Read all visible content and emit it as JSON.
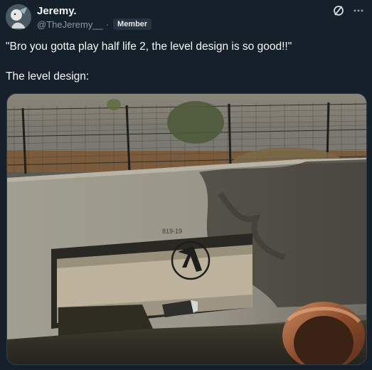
{
  "author": {
    "name": "Jeremy.",
    "handle": "@TheJeremy__",
    "separator": "·",
    "badge": "Member"
  },
  "icons": {
    "grok": "slash-circle-icon",
    "more": "more-horizontal-icon"
  },
  "tweet": {
    "line1": "\"Bro you gotta play half life 2, the level design is so good!!\"",
    "line2": "The level design:"
  },
  "photo": {
    "wall_marking": "819-19"
  },
  "colors": {
    "background": "#15202b",
    "text": "#f7f9f9",
    "secondary": "#8b98a5"
  }
}
